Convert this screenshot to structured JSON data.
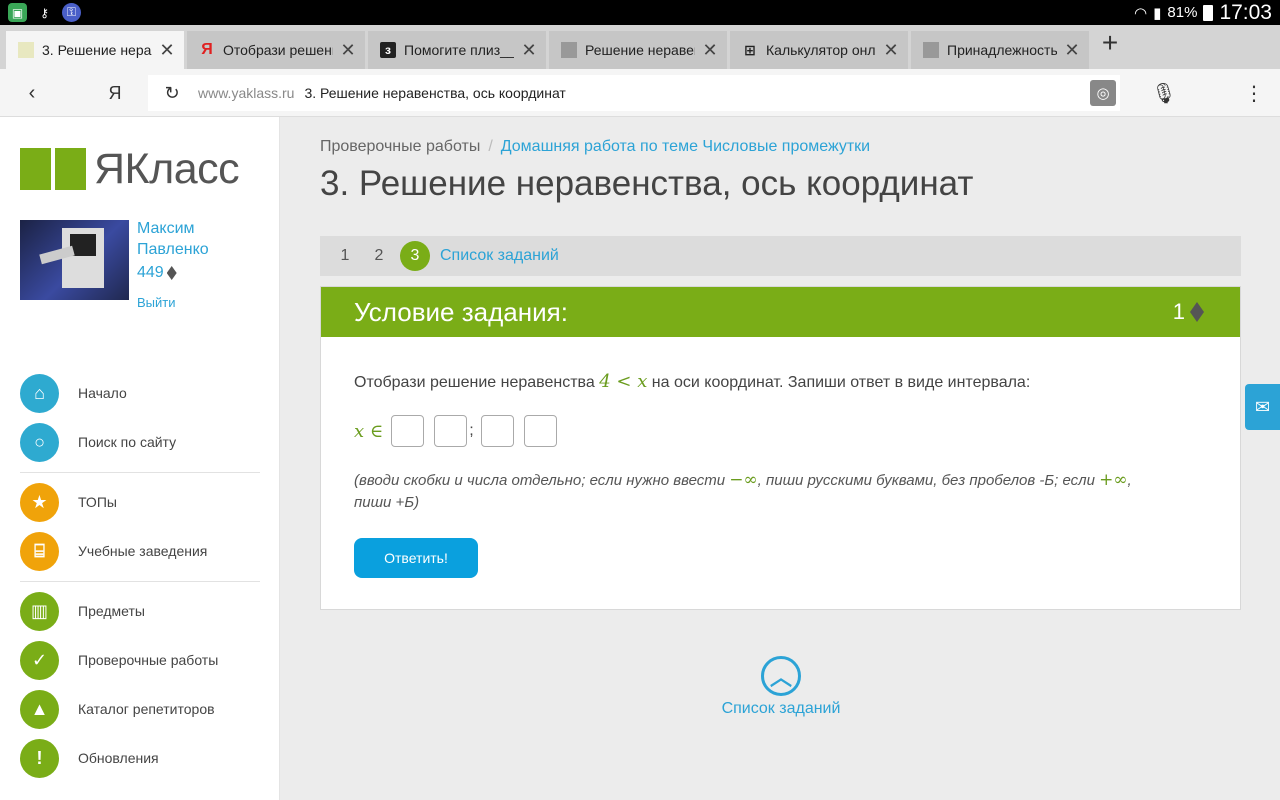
{
  "status": {
    "battery": "81%",
    "time": "17:03",
    "icons": [
      "app-icon",
      "key-icon",
      "vpn-icon",
      "wifi-icon",
      "signal-icon",
      "battery-icon"
    ]
  },
  "tabs": [
    {
      "label": "3. Решение нерав",
      "favicon": "yaklass-favicon",
      "active": true
    },
    {
      "label": "Отобрази решени",
      "favicon": "yandex-favicon",
      "active": false
    },
    {
      "label": "Помогите плиз__",
      "favicon": "znanija-favicon",
      "active": false
    },
    {
      "label": "Решение неравен",
      "favicon": "gray-favicon",
      "active": false
    },
    {
      "label": "Калькулятор онл",
      "favicon": "calc-favicon",
      "active": false
    },
    {
      "label": "Принадлежность",
      "favicon": "gray-favicon",
      "active": false
    }
  ],
  "toolbar": {
    "yandex": "Я",
    "domain": "www.yaklass.ru",
    "page_title": "3. Решение неравенства, ось координат"
  },
  "sidebar": {
    "logo": "ЯКласс",
    "user_name": "Максим Павленко",
    "points": "449",
    "logout": "Выйти",
    "nav": [
      {
        "label": "Начало",
        "icon": "home-icon",
        "color": "#2eaad0"
      },
      {
        "label": "Поиск по сайту",
        "icon": "search-icon",
        "color": "#2eaad0"
      },
      {
        "label": "ТОПы",
        "icon": "star-icon",
        "color": "#f0a30a"
      },
      {
        "label": "Учебные заведения",
        "icon": "school-icon",
        "color": "#f0a30a"
      },
      {
        "label": "Предметы",
        "icon": "book-icon",
        "color": "#7aad17"
      },
      {
        "label": "Проверочные работы",
        "icon": "check-icon",
        "color": "#7aad17"
      },
      {
        "label": "Каталог репетиторов",
        "icon": "graduation-cap-icon",
        "color": "#7aad17"
      },
      {
        "label": "Обновления",
        "icon": "exclamation-icon",
        "color": "#7aad17"
      }
    ]
  },
  "main": {
    "breadcrumb_root": "Проверочные работы",
    "breadcrumb_link": "Домашняя работа по теме Числовые промежутки",
    "title": "3. Решение неравенства, ось координат",
    "steps": [
      "1",
      "2",
      "3"
    ],
    "current_step": "3",
    "task_list_link": "Список заданий",
    "panel_title": "Условие задания:",
    "panel_points": "1",
    "question_before": "Отобрази решение неравенства ",
    "question_math": "4 < x",
    "question_after": " на оси координат. Запиши ответ в виде интервала:",
    "answer_prefix": "x ∈",
    "answer_separator": ";",
    "hint_1": "(вводи скобки и числа отдельно; если нужно ввести ",
    "hint_math_1": "−∞",
    "hint_2": ", пиши русскими буквами, без пробелов -Б; если ",
    "hint_math_2": "+∞",
    "hint_3": ",",
    "hint_4": "пиши +Б)",
    "submit_label": "Ответить!",
    "bottom_link": "Список заданий"
  }
}
